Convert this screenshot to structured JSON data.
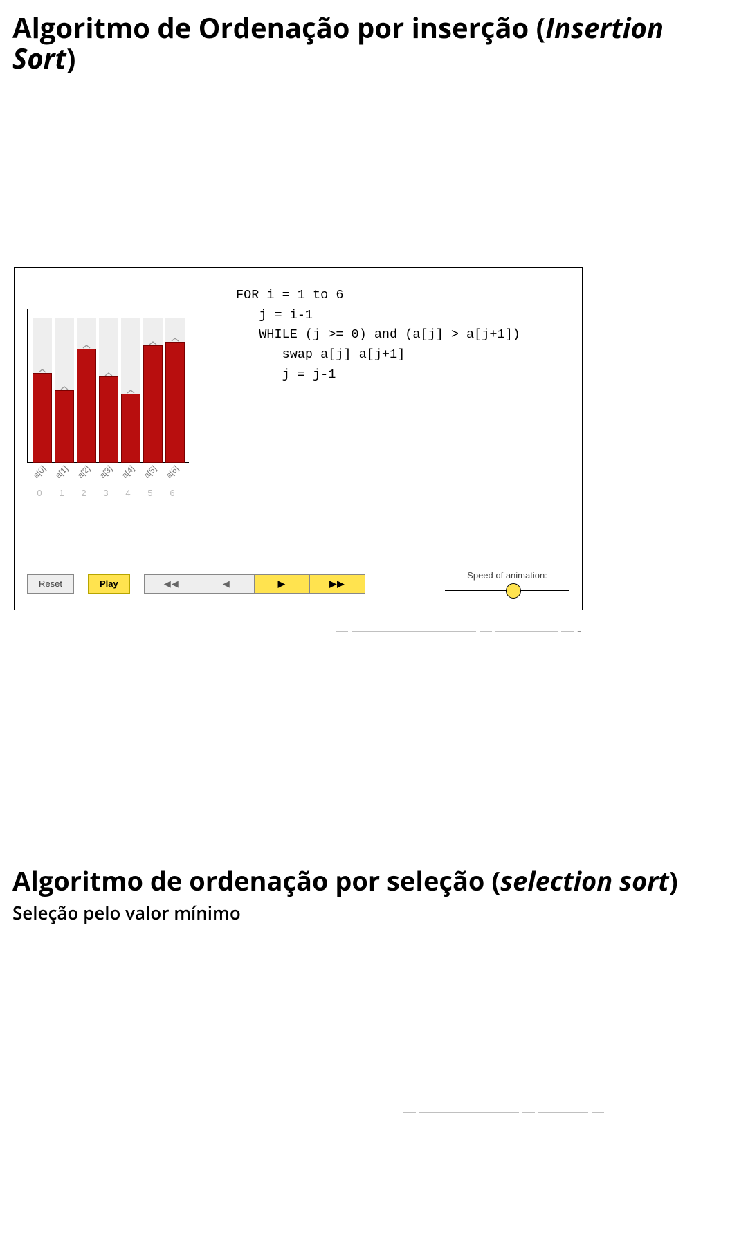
{
  "heading1": {
    "plain_pt": "Algoritmo de Ordenação por inserção (",
    "italic": "Insertion Sort",
    "close": ")"
  },
  "heading2": {
    "plain_pt": "Algoritmo de ordenação por seleção (",
    "italic": "selection sort",
    "close": ")"
  },
  "subtitle2": "Seleção pelo valor mínimo",
  "chart_data": {
    "type": "bar",
    "categories": [
      "a[0]",
      "a[1]",
      "a[2]",
      "a[3]",
      "a[4]",
      "a[5]",
      "a[6]"
    ],
    "indices": [
      "0",
      "1",
      "2",
      "3",
      "4",
      "5",
      "6"
    ],
    "values": [
      130,
      105,
      165,
      125,
      100,
      170,
      175
    ],
    "ylim": [
      0,
      210
    ],
    "bar_color": "#b80e0e",
    "title": "",
    "xlabel": "",
    "ylabel": ""
  },
  "pseudocode": {
    "lines": [
      "FOR i = 1 to 6",
      "   j = i-1",
      "   WHILE (j >= 0) and (a[j] > a[j+1])",
      "      swap a[j] a[j+1]",
      "      j = j-1"
    ]
  },
  "controls": {
    "reset": "Reset",
    "play": "Play",
    "step_back_fast": "◀◀",
    "step_back": "◀",
    "step_fwd": "▶",
    "step_fwd_fast": "▶▶",
    "speed_label": "Speed of animation:",
    "speed_value": 0.55
  },
  "separator1": "— ——————————  —   ————— — -",
  "separator2": "— ————————  —  ———— —"
}
